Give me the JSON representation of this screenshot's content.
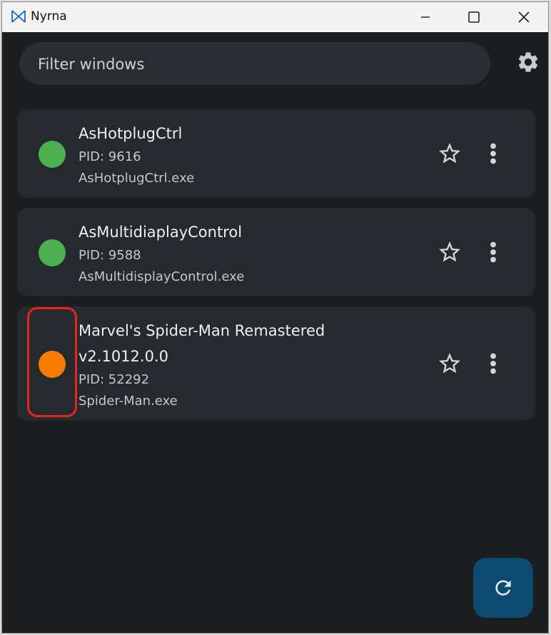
{
  "window": {
    "title": "Nyrna"
  },
  "filter": {
    "placeholder": "Filter windows"
  },
  "processes": [
    {
      "title": "AsHotplugCtrl",
      "pid": "PID: 9616",
      "exe": "AsHotplugCtrl.exe",
      "status_color": "#4caf50"
    },
    {
      "title": "AsMultidiaplayControl",
      "pid": "PID: 9588",
      "exe": "AsMultidisplayControl.exe",
      "status_color": "#4caf50"
    },
    {
      "title_line1": "Marvel's Spider-Man Remastered",
      "title_line2": "v2.1012.0.0",
      "pid": "PID: 52292",
      "exe": "Spider-Man.exe",
      "status_color": "#f57c00"
    }
  ],
  "icons": {
    "settings": "gear-icon",
    "favorite": "star-outline-icon",
    "more": "more-vert-icon",
    "refresh": "refresh-icon"
  },
  "colors": {
    "background": "#1c1d1f",
    "card": "#26292d",
    "fab": "#0d4a6f",
    "highlight": "#e8241c"
  }
}
